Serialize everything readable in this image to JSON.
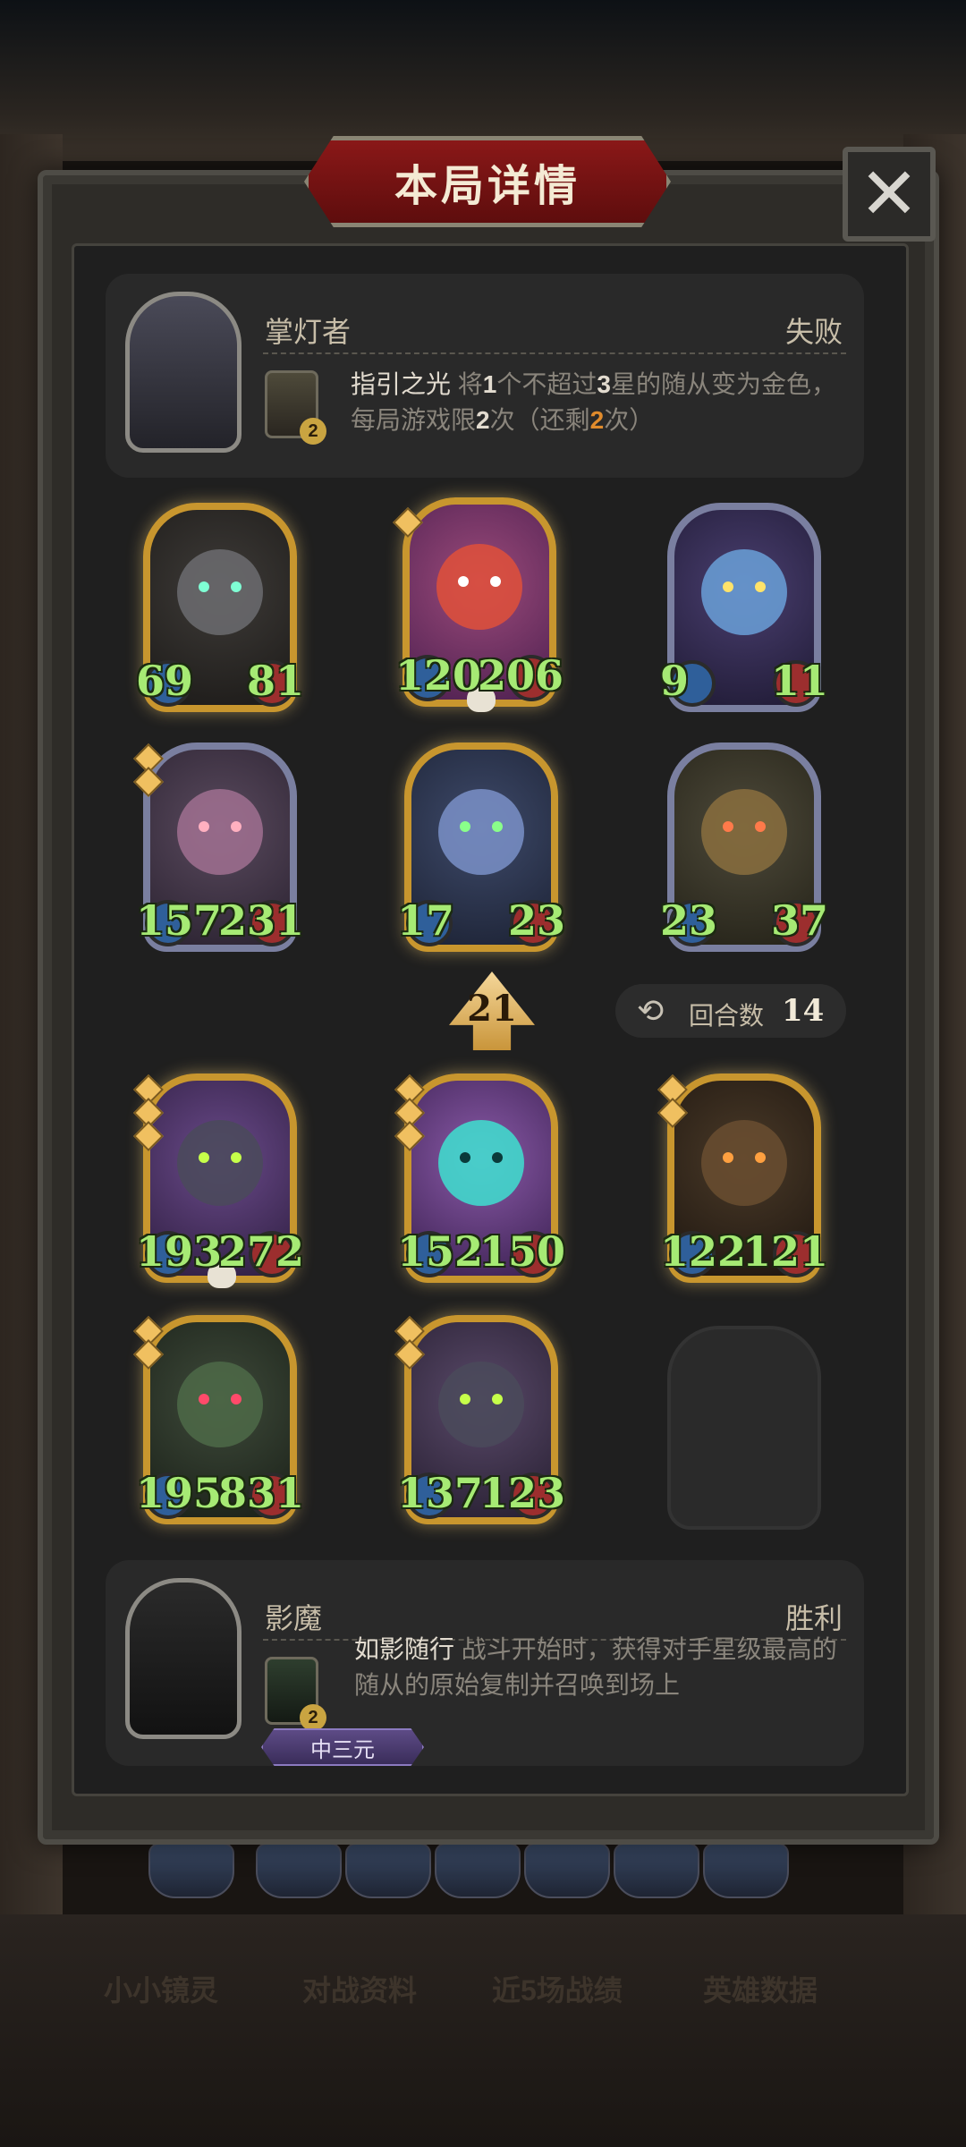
{
  "panel": {
    "title": "本局详情",
    "close_label": "✕"
  },
  "opponent": {
    "name": "掌灯者",
    "result": "失败",
    "skill": {
      "badge": "2",
      "name": "指引之光",
      "desc_a": " 将",
      "n1": "1",
      "desc_b": "个不超过",
      "n2": "3",
      "desc_c": "星的随从变为金色，每局游戏限",
      "n3": "2",
      "desc_d": "次（还剩",
      "n4": "2",
      "desc_e": "次）"
    }
  },
  "opponent_board": [
    {
      "attack": "69",
      "health": "81",
      "stars": 0,
      "skull": false
    },
    {
      "attack": "120",
      "health": "206",
      "stars": 1,
      "skull": true
    },
    {
      "attack": "9",
      "health": "11",
      "stars": 0,
      "skull": false
    },
    {
      "attack": "157",
      "health": "231",
      "stars": 2,
      "skull": false
    },
    {
      "attack": "17",
      "health": "23",
      "stars": 0,
      "skull": false
    },
    {
      "attack": "23",
      "health": "37",
      "stars": 0,
      "skull": false
    }
  ],
  "divider": {
    "level": "21",
    "round_label": "回合数",
    "round_value": "14",
    "round_icon": "refresh-icon"
  },
  "player_board": [
    {
      "attack": "193",
      "health": "272",
      "stars": 3,
      "skull": true
    },
    {
      "attack": "152",
      "health": "150",
      "stars": 3,
      "skull": false
    },
    {
      "attack": "122",
      "health": "121",
      "stars": 2,
      "skull": false
    },
    {
      "attack": "195",
      "health": "831",
      "stars": 2,
      "skull": false
    },
    {
      "attack": "137",
      "health": "123",
      "stars": 2,
      "skull": false
    }
  ],
  "player": {
    "name": "影魔",
    "result": "胜利",
    "title_tag": "中三元",
    "skill": {
      "badge": "2",
      "name": "如影随行",
      "desc": " 战斗开始时，获得对手星级最高的随从的原始复制并召唤到场上"
    }
  },
  "bottom_tabs": [
    "小小镜灵",
    "对战资料",
    "近5场战绩",
    "英雄数据"
  ],
  "colors": {
    "number_green": "#a6ea74",
    "accent_orange": "#e08b2c",
    "banner_red": "#8a1818",
    "gold_frame": "#c8962e"
  }
}
